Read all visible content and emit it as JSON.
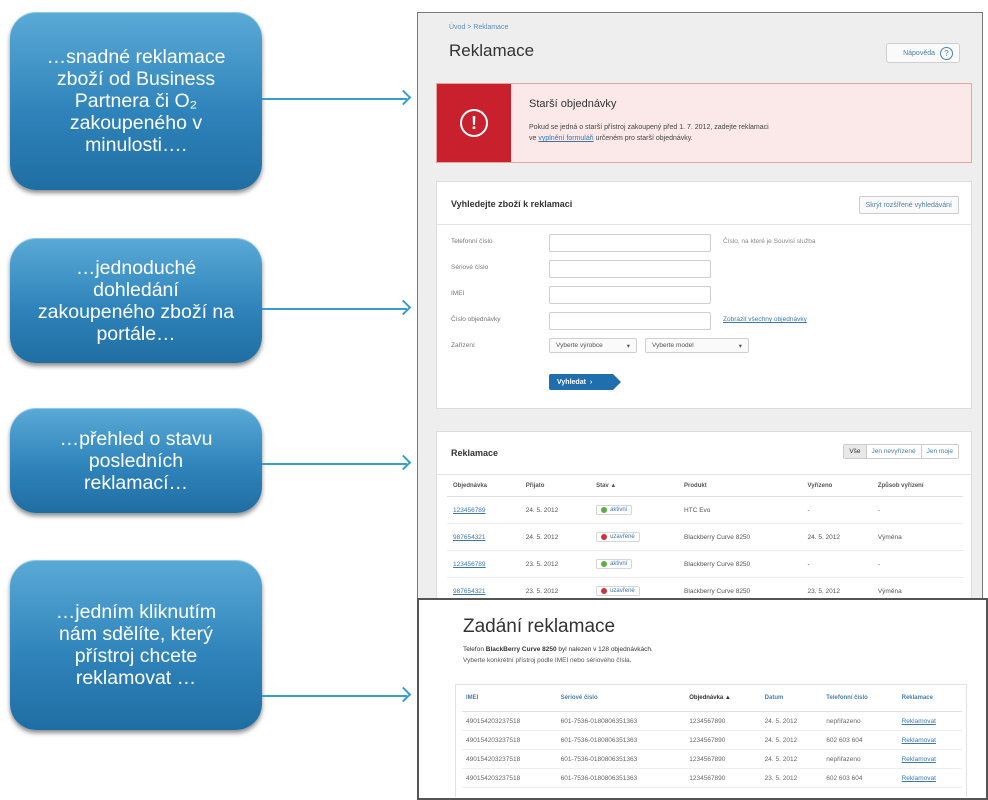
{
  "callouts": [
    {
      "lines": [
        "…snadné reklamace",
        "zboží od Business",
        "Partnera či O₂",
        "zakoupeného v",
        "minulosti…."
      ]
    },
    {
      "lines": [
        "…jednoduché",
        "dohledání",
        "zakoupeného zboží na",
        "portále…"
      ]
    },
    {
      "lines": [
        "…přehled o stavu",
        "posledních",
        "reklamací…"
      ]
    },
    {
      "lines": [
        "…jedním kliknutím",
        "nám sdělíte, který",
        "přístroj chcete",
        "reklamovat …"
      ]
    }
  ],
  "portal": {
    "breadcrumb": "Úvod > Reklamace",
    "title": "Reklamace",
    "help_label": "Nápověda",
    "alert": {
      "title": "Starší objednávky",
      "text_before": "Pokud se jedná o starší přístroj zakoupený před 1. 7. 2012, zadejte reklamaci",
      "text_prefix": "ve",
      "link": "vyplnění formuláři",
      "text_after": "určeném pro starší objednávky."
    },
    "search": {
      "heading": "Vyhledejte zboží k reklamaci",
      "save_label": "Skrýt rozšířené vyhledávání",
      "fields": [
        {
          "label": "Telefonní číslo",
          "hint": "Číslo, na které je Souvisí služba"
        },
        {
          "label": "Sériové číslo",
          "hint": ""
        },
        {
          "label": "IMEI",
          "hint": ""
        },
        {
          "label": "Číslo objednávky",
          "hint": ""
        }
      ],
      "orders_link": "Zobrazit všechny objednávky",
      "device_label": "Zařízení",
      "vendor_select": "Vyberte výrobce",
      "model_select": "Vyberte model",
      "submit_label": "Vyhledat"
    },
    "complaints": {
      "heading": "Reklamace",
      "filters": [
        "Vše",
        "Jen nevyřízené",
        "Jen moje"
      ],
      "columns": [
        "Objednávka",
        "Přijato",
        "Stav ▲",
        "Produkt",
        "Vyřízeno",
        "Způsob vyřízení"
      ],
      "rows": [
        {
          "order": "123456789",
          "date": "24. 5. 2012",
          "status": "aktivní",
          "status_color": "#5ab03c",
          "product": "HTC Evo",
          "resolved": "-",
          "method": "-"
        },
        {
          "order": "987654321",
          "date": "24. 5. 2012",
          "status": "uzavřené",
          "status_color": "#d2313b",
          "product": "Blackberry Curve 8250",
          "resolved": "24. 5. 2012",
          "method": "Výměna"
        },
        {
          "order": "123456789",
          "date": "23. 5. 2012",
          "status": "aktivní",
          "status_color": "#5ab03c",
          "product": "Blackberry Curve 8250",
          "resolved": "-",
          "method": "-"
        },
        {
          "order": "987654321",
          "date": "23. 5. 2012",
          "status": "uzavřené",
          "status_color": "#d2313b",
          "product": "Blackberry Curve 8250",
          "resolved": "23. 5. 2012",
          "method": "Výměna"
        }
      ]
    }
  },
  "zadani": {
    "title": "Zadání reklamace",
    "desc_prefix": "Telefon",
    "desc_product": "BlackBerry Curve 8250",
    "desc_suffix": "byl nalezen v 128 objednávkách.",
    "desc_line2": "Vyberte konkrétní přístroj podle IMEI nebo sériového čísla.",
    "columns": [
      "IMEI",
      "Sériové číslo",
      "Objednávka ▲",
      "Datum",
      "Telefonní číslo",
      "Reklamace"
    ],
    "rows": [
      {
        "imei": "490154203237518",
        "serial": "601-7536-0180806351363",
        "order": "1234567890",
        "date": "24. 5. 2012",
        "phone": "nepřiřazeno",
        "action": "Reklamovat"
      },
      {
        "imei": "490154203237518",
        "serial": "601-7536-0180806351363",
        "order": "1234567890",
        "date": "24. 5. 2012",
        "phone": "602 603 604",
        "action": "Reklamovat"
      },
      {
        "imei": "490154203237518",
        "serial": "601-7536-0180806351363",
        "order": "1234567890",
        "date": "24. 5. 2012",
        "phone": "nepřiřazeno",
        "action": "Reklamovat"
      },
      {
        "imei": "490154203237518",
        "serial": "601-7536-0180806351363",
        "order": "1234567890",
        "date": "23. 5. 2012",
        "phone": "602 603 604",
        "action": "Reklamovat"
      }
    ]
  }
}
